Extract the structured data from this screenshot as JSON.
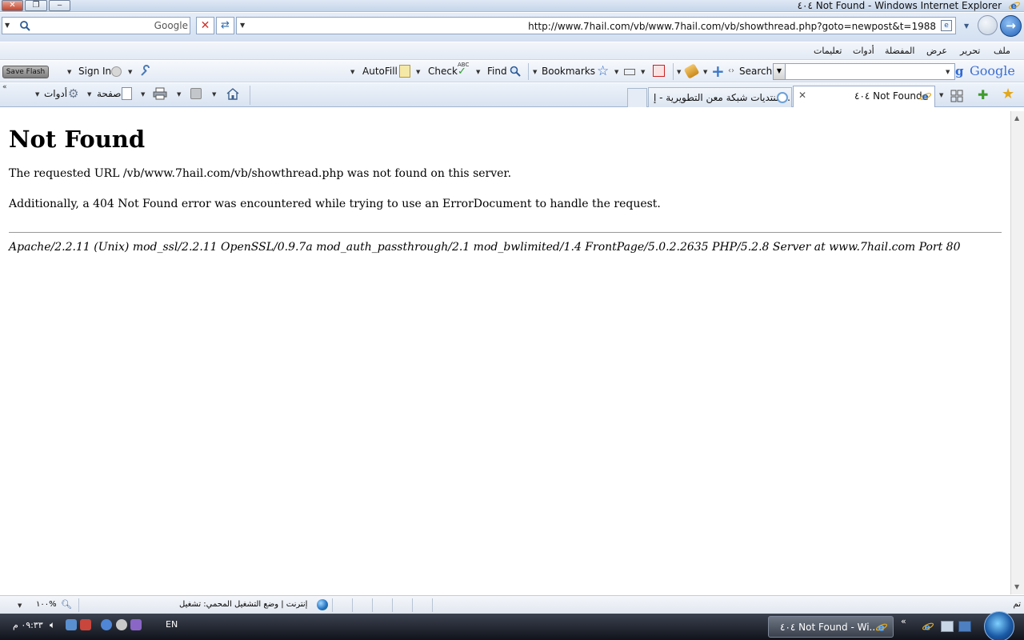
{
  "window": {
    "title": "٤٠٤ Not Found - Windows Internet Explorer",
    "close_glyph": "✕",
    "restore_glyph": "❐",
    "minimize_glyph": "‒"
  },
  "address_bar": {
    "url": "http://www.7hail.com/vb/www.7hail.com/vb/showthread.php?goto=newpost&t=1988",
    "search_engine_label": "Google",
    "stop_glyph": "✕",
    "refresh_glyph": "⇄",
    "forward_glyph": "→"
  },
  "menu": {
    "items": [
      "ملف",
      "تحرير",
      "عرض",
      "المفضلة",
      "أدوات",
      "تعليمات"
    ]
  },
  "google_toolbar": {
    "save_flash": "Save Flash",
    "sign_in": "Sign In",
    "autofill": "AutoFill",
    "check": "Check",
    "check_badge": "ABC",
    "find": "Find",
    "bookmarks": "Bookmarks",
    "search": "Search",
    "logo": "Google"
  },
  "command_bar": {
    "tools": "أدوات",
    "page": "صفحة"
  },
  "tabs": [
    {
      "label": "منتديات شبكة معن التطويرية - إ...",
      "active": false
    },
    {
      "label": "٤٠٤ Not Found",
      "active": true
    }
  ],
  "page": {
    "heading": "Not Found",
    "message_1": "The requested URL /vb/www.7hail.com/vb/showthread.php was not found on this server.",
    "message_2": "Additionally, a 404 Not Found error was encountered while trying to use an ErrorDocument to handle the request.",
    "server_signature": "Apache/2.2.11 (Unix) mod_ssl/2.2.11 OpenSSL/0.9.7a mod_auth_passthrough/2.1 mod_bwlimited/1.4 FrontPage/5.0.2.2635 PHP/5.2.8 Server at www.7hail.com Port 80"
  },
  "status_bar": {
    "done": "تم",
    "zone": "إنترنت | وضع التشغيل المحمي: تشغيل",
    "zoom": "١٠٠%"
  },
  "taskbar": {
    "clock": "٠٩:٣٣ م",
    "language": "EN",
    "window_button": "٤٠٤ Not Found - Wi...",
    "quick_launch_chevron": "«"
  }
}
